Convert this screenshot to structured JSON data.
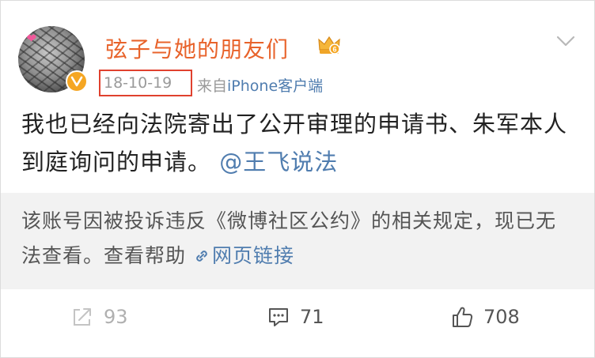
{
  "post": {
    "user": {
      "name": "弦子与她的朋友们"
    },
    "meta": {
      "date": "18-10-19",
      "source_prefix": "来自",
      "device": "iPhone客户端"
    },
    "text_line": "我也已经向法院寄出了公开审理的申请书、朱军本人到庭询问的申请。",
    "mention": "@王飞说法"
  },
  "notice": {
    "text": "该账号因被投诉违反《微博社区公约》的相关规定，现已无法查看。查看帮助",
    "link_label": "网页链接"
  },
  "actions": {
    "repost_count": "93",
    "comment_count": "71",
    "like_count": "708"
  },
  "colors": {
    "username": "#e8632b",
    "link": "#507daf",
    "highlight_box": "#e0412e",
    "badge": "#f5a623"
  },
  "icons": [
    "verified-badge-icon",
    "crown-icon",
    "chevron-down-icon",
    "link-icon",
    "repost-icon",
    "comment-icon",
    "like-icon"
  ]
}
